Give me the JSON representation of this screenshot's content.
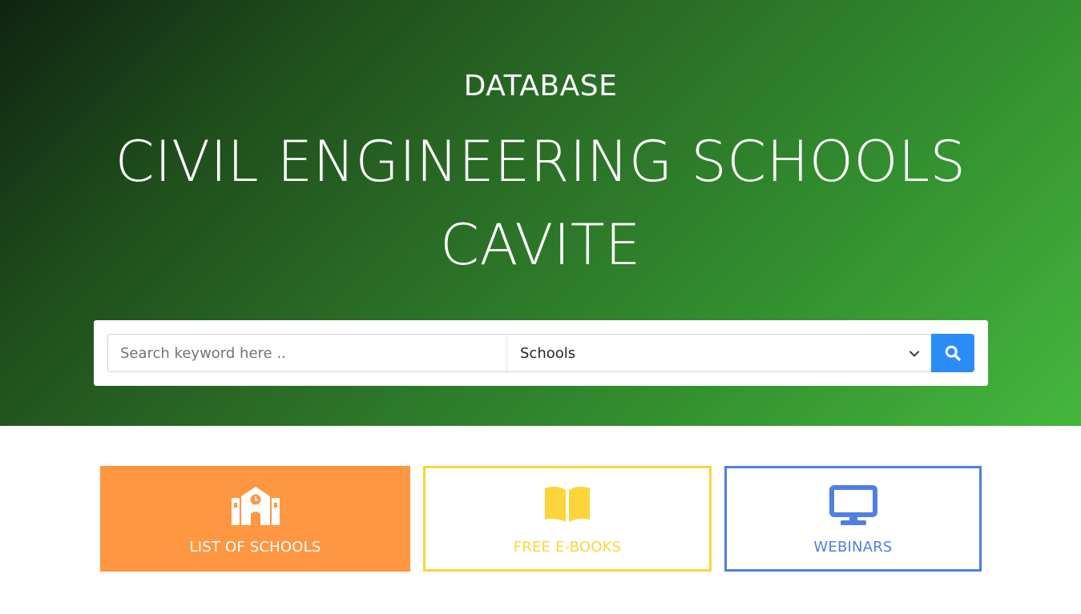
{
  "hero": {
    "eyebrow": "DATABASE",
    "title": "CIVIL ENGINEERING SCHOOLS CAVITE"
  },
  "search": {
    "placeholder": "Search keyword here ..",
    "value": "",
    "category_selected": "Schools",
    "button_icon": "search-icon"
  },
  "cards": [
    {
      "label": "LIST OF SCHOOLS",
      "icon": "school-icon",
      "color": "#ff9642"
    },
    {
      "label": "FREE E-BOOKS",
      "icon": "open-book-icon",
      "color": "#fdd53a"
    },
    {
      "label": "WEBINARS",
      "icon": "monitor-icon",
      "color": "#4f7fe3"
    }
  ],
  "colors": {
    "hero_gradient_start": "#0f2410",
    "hero_gradient_end": "#45b73d",
    "search_button": "#2b8cf8"
  }
}
